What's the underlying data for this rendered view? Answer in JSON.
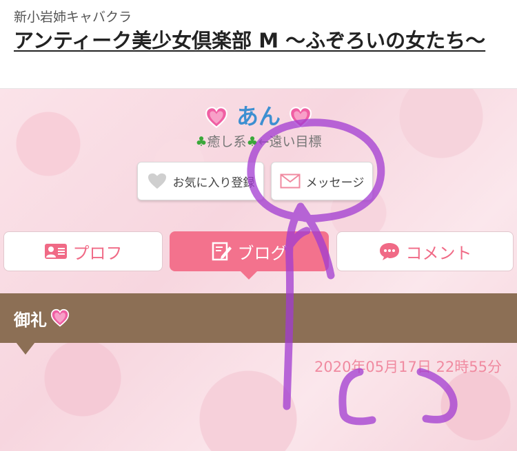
{
  "header": {
    "area": "新小岩姉キャバクラ",
    "shop_title": "アンティーク美少女倶楽部 M 〜ふぞろいの女たち〜"
  },
  "profile": {
    "name": "あん",
    "catch_before": "癒し系",
    "catch_after": "←遠い目標"
  },
  "buttons": {
    "favorite": "お気に入り登録",
    "message": "メッセージ"
  },
  "tabs": [
    {
      "label": "プロフ",
      "icon": "profile-card-icon",
      "active": false
    },
    {
      "label": "ブログ",
      "icon": "blog-edit-icon",
      "active": true
    },
    {
      "label": "コメント",
      "icon": "comment-bubble-icon",
      "active": false
    }
  ],
  "post": {
    "title": "御礼",
    "date": "2020年05月17日 22時55分"
  },
  "annotation": {
    "text": "ここ",
    "color": "#a13bd1"
  },
  "colors": {
    "accent_pink": "#f3728d",
    "name_blue": "#3d8fd1",
    "bar_brown": "#8c6f55"
  }
}
